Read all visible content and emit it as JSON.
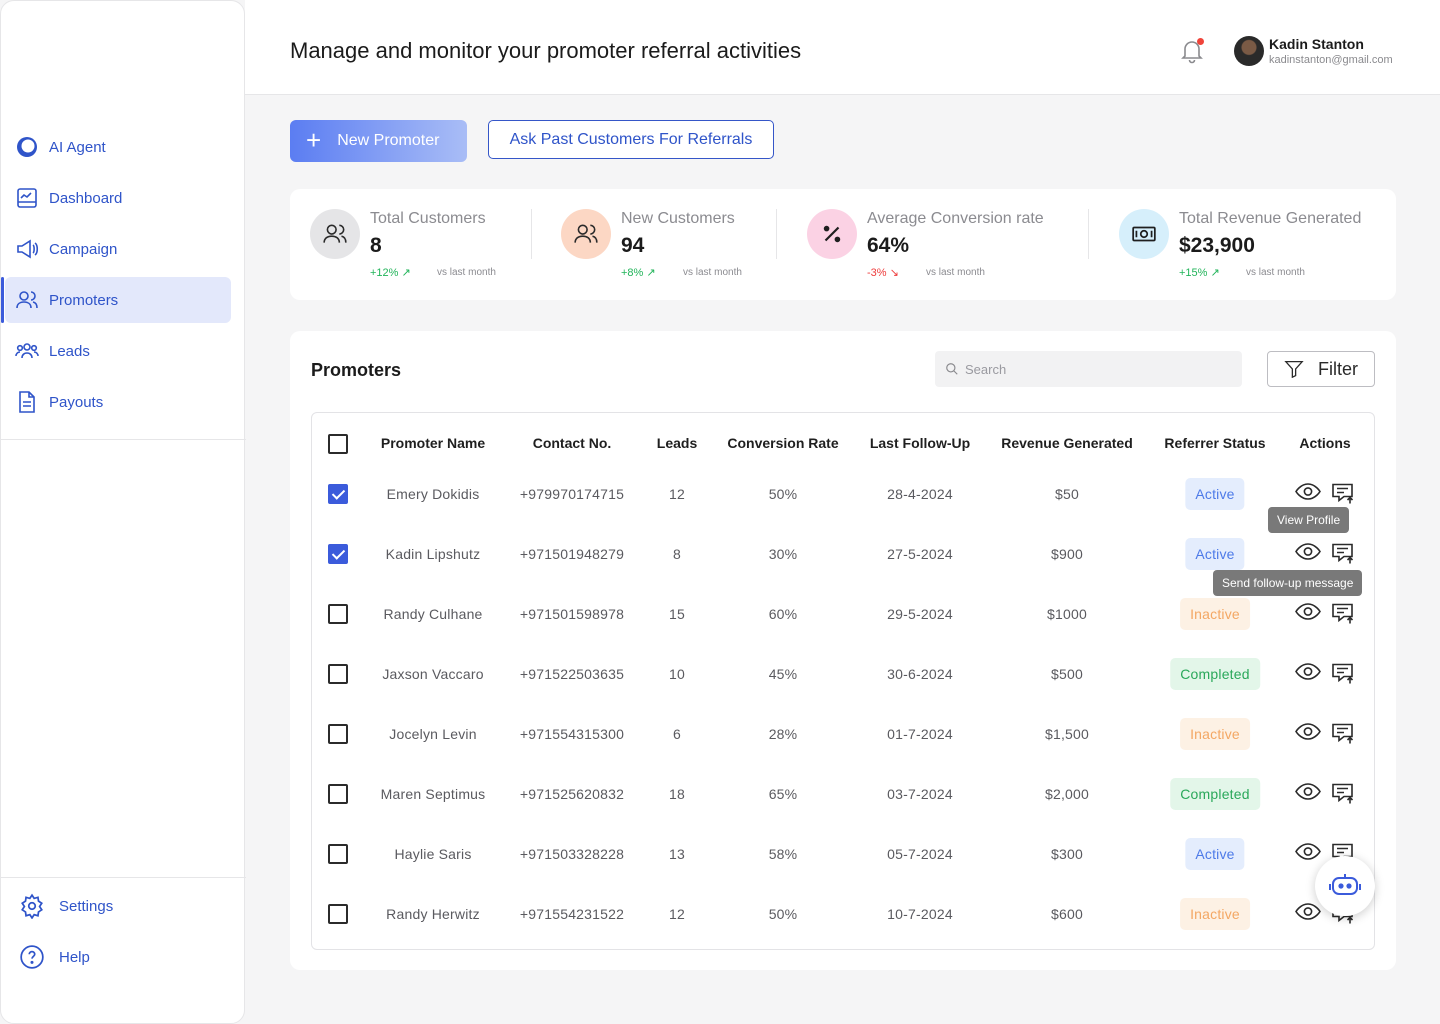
{
  "sidebar": {
    "items": [
      {
        "label": "AI Agent",
        "icon": "ai-agent-icon"
      },
      {
        "label": "Dashboard",
        "icon": "dashboard-icon"
      },
      {
        "label": "Campaign",
        "icon": "megaphone-icon"
      },
      {
        "label": "Promoters",
        "icon": "users-icon",
        "active": true
      },
      {
        "label": "Leads",
        "icon": "leads-icon"
      },
      {
        "label": "Payouts",
        "icon": "document-icon"
      }
    ],
    "bottom": [
      {
        "label": "Settings",
        "icon": "gear-icon"
      },
      {
        "label": "Help",
        "icon": "help-icon"
      }
    ]
  },
  "header": {
    "title": "Manage and monitor your promoter referral activities",
    "user_name": "Kadin Stanton",
    "user_email": "kadinstanton@gmail.com"
  },
  "actions": {
    "new_promoter": "New Promoter",
    "ask_referrals": "Ask Past Customers For Referrals"
  },
  "stats": [
    {
      "label": "Total Customers",
      "value": "8",
      "change": "+12%",
      "trend": "up",
      "vs": "vs last month",
      "icon": "users-icon",
      "color": "#e5e5e7"
    },
    {
      "label": "New Customers",
      "value": "94",
      "change": "+8%",
      "trend": "up",
      "vs": "vs last month",
      "icon": "users-icon",
      "color": "#fcd7c4"
    },
    {
      "label": "Average Conversion rate",
      "value": "64%",
      "change": "-3%",
      "trend": "down",
      "vs": "vs last month",
      "icon": "percent-icon",
      "color": "#fbd2e4"
    },
    {
      "label": "Total Revenue Generated",
      "value": "$23,900",
      "change": "+15%",
      "trend": "up",
      "vs": "vs last month",
      "icon": "cash-icon",
      "color": "#d6effb"
    }
  ],
  "promoters": {
    "title": "Promoters",
    "search_placeholder": "Search",
    "filter_label": "Filter",
    "columns": [
      "Promoter Name",
      "Contact No.",
      "Leads",
      "Conversion Rate",
      "Last Follow-Up",
      "Revenue Generated",
      "Referrer Status",
      "Actions"
    ],
    "rows": [
      {
        "checked": true,
        "name": "Emery Dokidis",
        "contact": "+979970174715",
        "leads": "12",
        "rate": "50%",
        "followup": "28-4-2024",
        "revenue": "$50",
        "status": "Active"
      },
      {
        "checked": true,
        "name": "Kadin Lipshutz",
        "contact": "+971501948279",
        "leads": "8",
        "rate": "30%",
        "followup": "27-5-2024",
        "revenue": "$900",
        "status": "Active"
      },
      {
        "checked": false,
        "name": "Randy Culhane",
        "contact": "+971501598978",
        "leads": "15",
        "rate": "60%",
        "followup": "29-5-2024",
        "revenue": "$1000",
        "status": "Inactive"
      },
      {
        "checked": false,
        "name": "Jaxson Vaccaro",
        "contact": "+971522503635",
        "leads": "10",
        "rate": "45%",
        "followup": "30-6-2024",
        "revenue": "$500",
        "status": "Completed"
      },
      {
        "checked": false,
        "name": "Jocelyn Levin",
        "contact": "+971554315300",
        "leads": "6",
        "rate": "28%",
        "followup": "01-7-2024",
        "revenue": "$1,500",
        "status": "Inactive"
      },
      {
        "checked": false,
        "name": "Maren Septimus",
        "contact": "+971525620832",
        "leads": "18",
        "rate": "65%",
        "followup": "03-7-2024",
        "revenue": "$2,000",
        "status": "Completed"
      },
      {
        "checked": false,
        "name": "Haylie Saris",
        "contact": "+971503328228",
        "leads": "13",
        "rate": "58%",
        "followup": "05-7-2024",
        "revenue": "$300",
        "status": "Active"
      },
      {
        "checked": false,
        "name": "Randy Herwitz",
        "contact": "+971554231522",
        "leads": "12",
        "rate": "50%",
        "followup": "10-7-2024",
        "revenue": "$600",
        "status": "Inactive"
      }
    ]
  },
  "tooltips": {
    "view_profile": "View Profile",
    "send_followup": "Send follow-up message"
  },
  "colors": {
    "accent": "#3b5bdb",
    "active_bg": "#e4edfd",
    "inactive_bg": "#fdf1e4",
    "completed_bg": "#e3f6e9"
  }
}
